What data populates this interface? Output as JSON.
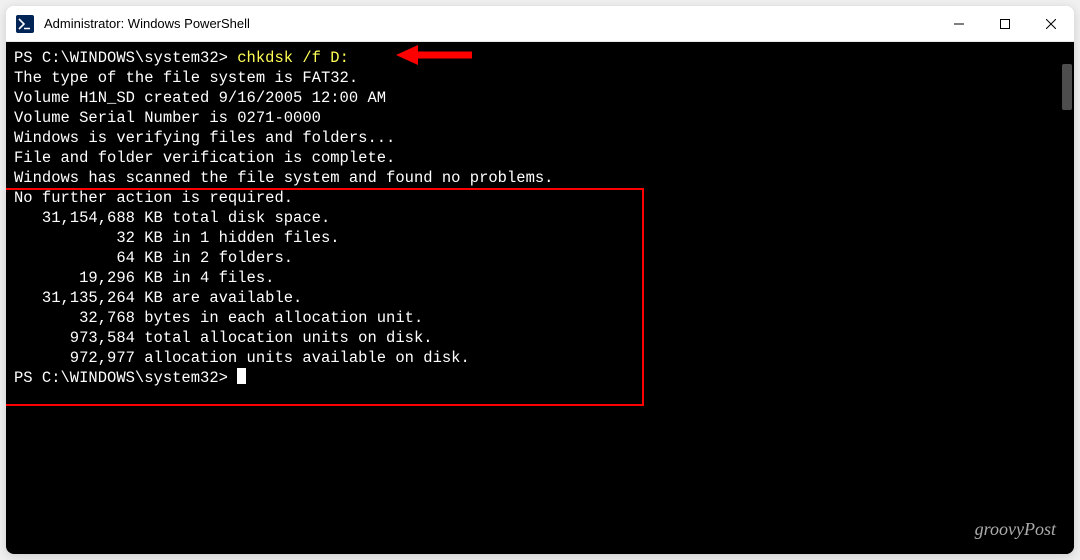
{
  "window": {
    "title": "Administrator: Windows PowerShell"
  },
  "prompt1": {
    "path": "PS C:\\WINDOWS\\system32> ",
    "command": "chkdsk /f D:"
  },
  "output": {
    "l1": "The type of the file system is FAT32.",
    "l2": "Volume H1N_SD created 9/16/2005 12:00 AM",
    "l3": "Volume Serial Number is 0271-0000",
    "l4": "Windows is verifying files and folders...",
    "l5": "File and folder verification is complete.",
    "l6": "",
    "l7": "Windows has scanned the file system and found no problems.",
    "l8": "No further action is required.",
    "l9": "   31,154,688 KB total disk space.",
    "l10": "           32 KB in 1 hidden files.",
    "l11": "           64 KB in 2 folders.",
    "l12": "       19,296 KB in 4 files.",
    "l13": "   31,135,264 KB are available.",
    "l14": "",
    "l15": "       32,768 bytes in each allocation unit.",
    "l16": "      973,584 total allocation units on disk.",
    "l17": "      972,977 allocation units available on disk."
  },
  "prompt2": {
    "path": "PS C:\\WINDOWS\\system32> "
  },
  "watermark": "groovyPost"
}
